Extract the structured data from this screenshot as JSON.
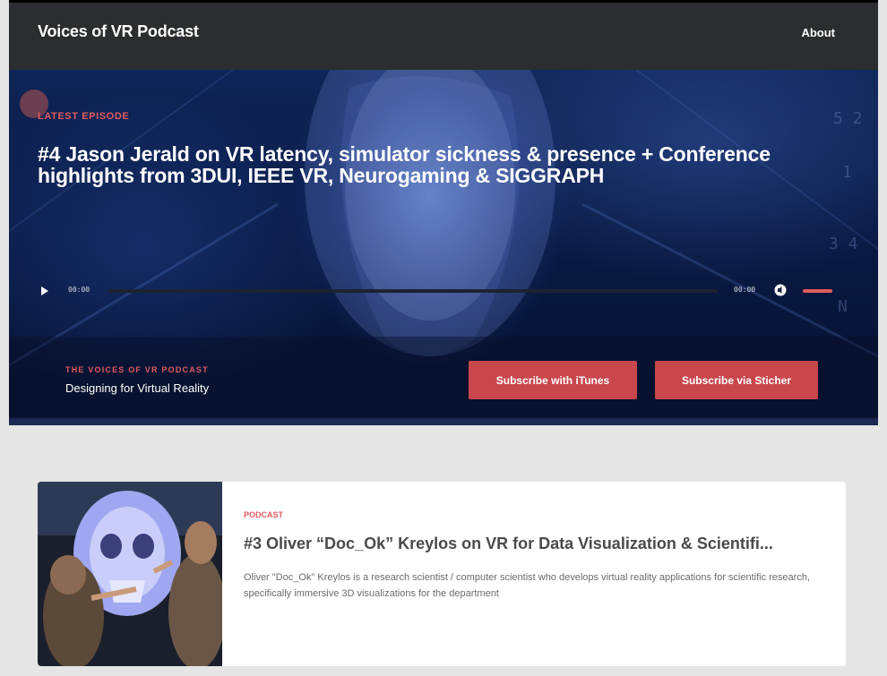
{
  "header": {
    "brand": "Voices of VR Podcast",
    "nav": [
      {
        "label": "About"
      }
    ]
  },
  "hero": {
    "label": "LATEST EPISODE",
    "title": "#4 Jason Jerald on VR latency, simulator sickness & presence + Conference highlights from 3DUI, IEEE VR, Neurogaming & SIGGRAPH",
    "player": {
      "current_time": "00:00",
      "total_time": "00:00",
      "progress": 0,
      "volume": 1
    }
  },
  "subscribe": {
    "eyebrow": "THE VOICES OF VR PODCAST",
    "tagline": "Designing for Virtual Reality",
    "itunes_label": "Subscribe with iTunes",
    "stitcher_label": "Subscribe via Sticher"
  },
  "episodes": [
    {
      "category": "PODCAST",
      "title": "#3 Oliver “Doc_Ok” Kreylos on VR for Data Visualization & Scientifi...",
      "excerpt": "Oliver \"Doc_Ok\" Kreylos is a research scientist / computer scientist who develops virtual reality applications for scientific research, specifically immersive 3D visualizations for the department"
    }
  ],
  "colors": {
    "accent": "#e05b5f",
    "button": "#c8474d",
    "nav_bg": "#2c2d30",
    "page_bg": "#e5e5e5"
  }
}
